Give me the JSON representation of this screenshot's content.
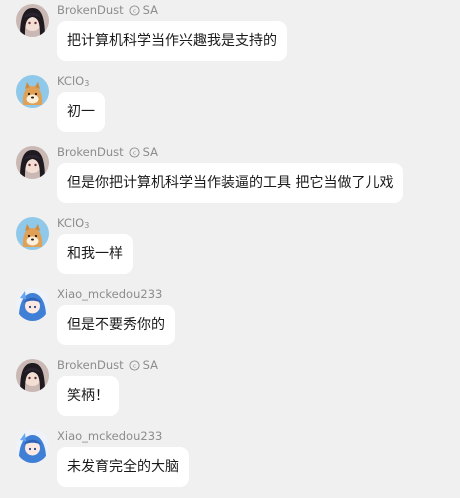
{
  "messages": [
    {
      "sender": "BrokenDust",
      "badge": "SA",
      "avatar": "dark-haired-avatar-icon",
      "text": "把计算机科学当作兴趣我是支持的"
    },
    {
      "sender": "KClO",
      "sender_sub": "3",
      "avatar": "shiba-dog-avatar-icon",
      "text": "初一"
    },
    {
      "sender": "BrokenDust",
      "badge": "SA",
      "avatar": "dark-haired-avatar-icon",
      "text": "但是你把计算机科学当作装逼的工具 把它当做了儿戏"
    },
    {
      "sender": "KClO",
      "sender_sub": "3",
      "avatar": "shiba-dog-avatar-icon",
      "text": "和我一样"
    },
    {
      "sender": "Xiao_mckedou233",
      "avatar": "blue-haired-anime-avatar-icon",
      "text": "但是不要秀你的"
    },
    {
      "sender": "BrokenDust",
      "badge": "SA",
      "avatar": "dark-haired-avatar-icon",
      "text": "笑柄！"
    },
    {
      "sender": "Xiao_mckedou233",
      "avatar": "blue-haired-anime-avatar-icon",
      "text": "未发育完全的大脑"
    }
  ],
  "colors": {
    "background": "#f0f0f0",
    "bubble": "#ffffff",
    "sender_text": "#8c8c8c",
    "message_text": "#1a1a1a"
  }
}
